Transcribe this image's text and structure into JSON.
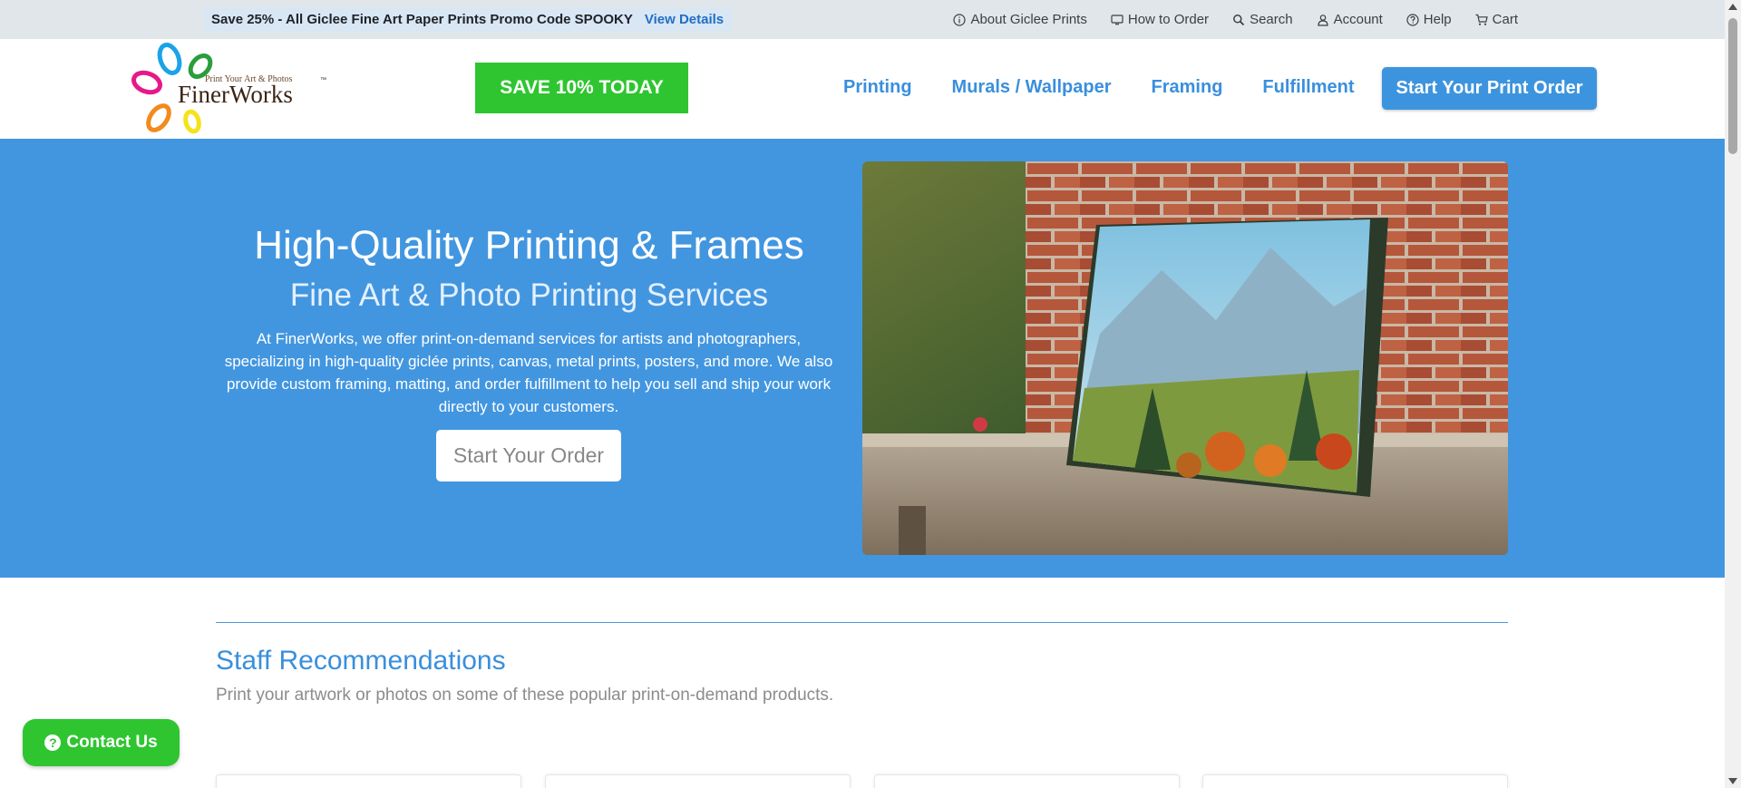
{
  "topbar": {
    "promo_text": "Save 25% - All Giclee Fine Art Paper Prints Promo Code SPOOKY",
    "promo_link": "View Details",
    "utility_links": [
      {
        "label": "About Giclee Prints",
        "icon": "info-circle-icon"
      },
      {
        "label": "How to Order",
        "icon": "monitor-icon"
      },
      {
        "label": "Search",
        "icon": "search-icon"
      },
      {
        "label": "Account",
        "icon": "user-icon"
      },
      {
        "label": "Help",
        "icon": "question-circle-icon"
      },
      {
        "label": "Cart",
        "icon": "cart-icon"
      }
    ]
  },
  "header": {
    "logo": {
      "tagline": "Print Your Art & Photos",
      "brand_finer": "Finer",
      "brand_works": "Works",
      "tm": "™"
    },
    "save_button": "SAVE 10% TODAY",
    "nav": [
      "Printing",
      "Murals / Wallpaper",
      "Framing",
      "Fulfillment"
    ],
    "order_button": "Start Your Print Order"
  },
  "hero": {
    "title": "High-Quality Printing & Frames",
    "subtitle": "Fine Art & Photo Printing Services",
    "body": "At FinerWorks, we offer print-on-demand services for artists and photographers, specializing in high-quality giclée prints, canvas, metal prints, posters, and more. We also provide custom framing, matting, and order fulfillment to help you sell and ship your work directly to your customers.",
    "button": "Start Your Order",
    "image": "canvas-landscape-on-wooden-bench-photo"
  },
  "staff": {
    "title": "Staff Recommendations",
    "description": "Print your artwork or photos on some of these popular print-on-demand products."
  },
  "contact_button": "Contact Us",
  "colors": {
    "brand_blue": "#4296e0",
    "link_blue": "#3a8fdc",
    "cta_green": "#2fc530",
    "topbar_bg": "#e1e6ea"
  }
}
